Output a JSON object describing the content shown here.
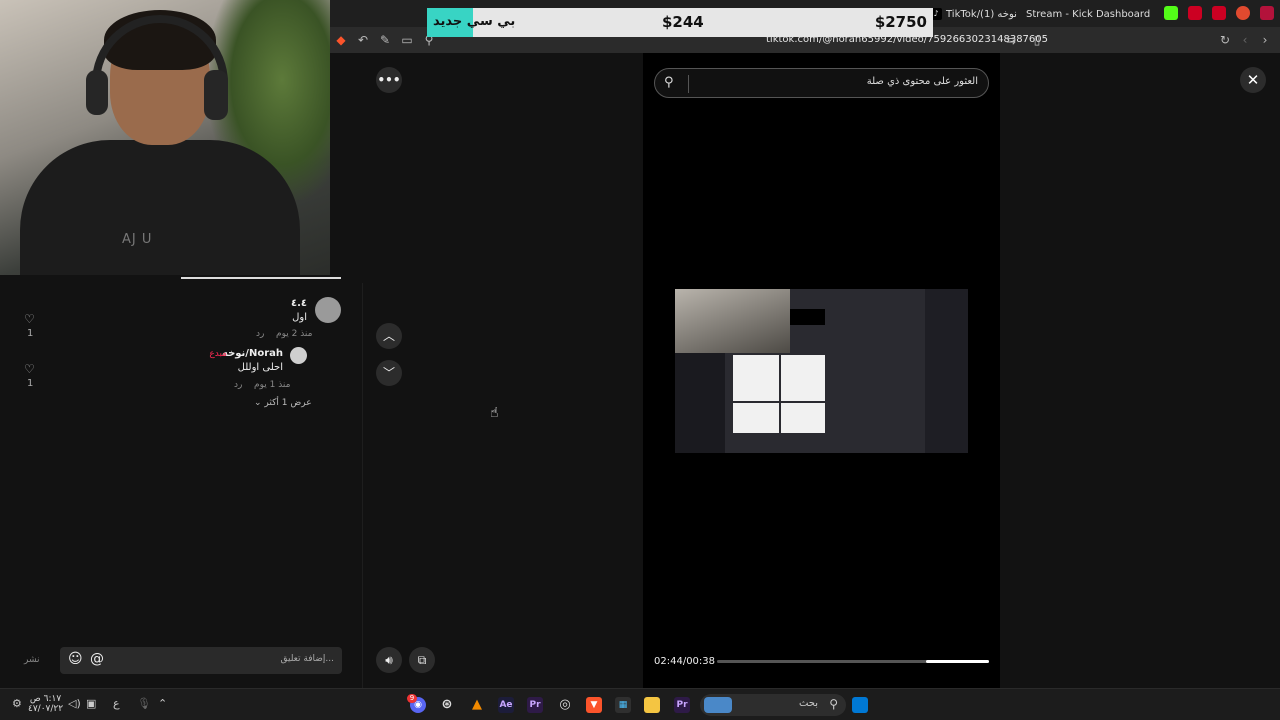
{
  "browser": {
    "tabs": [
      {
        "label": "TikTok/(1) نوخه"
      },
      {
        "label": "Stream - Kick Dashboard"
      }
    ],
    "url": "tiktok.com/@norah65992/video/7592663023148387605",
    "colors": {
      "kick": "#53fc18",
      "youtube": "#ff0033"
    }
  },
  "donation": {
    "label": "بي سي جديد",
    "amount_left": "$244",
    "amount_right": "$2750",
    "colors": {
      "accent": "#38d4c4"
    }
  },
  "webcam": {
    "shirt_text": "AJ  U"
  },
  "comments": {
    "items": [
      {
        "author": "٤.٤",
        "text": "اول",
        "time": "منذ 2 يوم",
        "reply": "رد",
        "likes": "1"
      },
      {
        "author": "نوخه/Norah",
        "badge": "مبدع",
        "text": "احلى اوللل",
        "time": "منذ 1 يوم",
        "reply": "رد",
        "likes": "1"
      }
    ],
    "show_more": "عرض 1 أكثر",
    "input_placeholder": "إضافة تعليق...",
    "post_label": "نشر",
    "colors": {
      "creator_badge": "#fe2c55"
    }
  },
  "video": {
    "search_placeholder": "العثور على محتوى ذي صلة",
    "time": "02:44/00:38",
    "progress": 0.23
  },
  "taskbar": {
    "search_label": "بحث",
    "clock_time": "٦:١٧ ص",
    "clock_date": "٤٧/٠٧/٢٢",
    "lang": "ع",
    "notification_count": "9"
  }
}
